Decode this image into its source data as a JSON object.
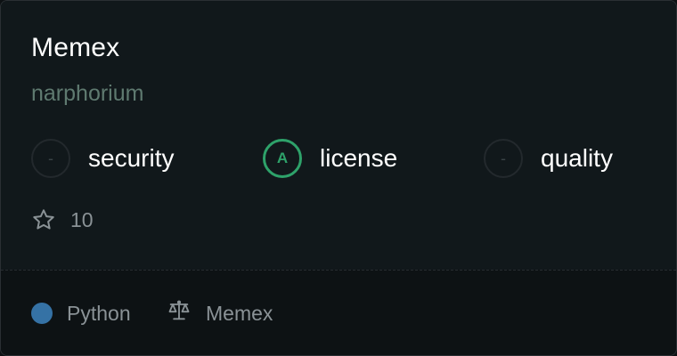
{
  "repo": {
    "name": "Memex",
    "owner": "narphorium"
  },
  "scores": [
    {
      "grade": "-",
      "label": "security",
      "state": "empty"
    },
    {
      "grade": "A",
      "label": "license",
      "state": "good"
    },
    {
      "grade": "-",
      "label": "quality",
      "state": "empty"
    }
  ],
  "stars": {
    "icon": "star-icon",
    "count": "10"
  },
  "footer": {
    "language": "Python",
    "language_color": "#3572A5",
    "license_icon": "scale-icon",
    "license": "Memex"
  },
  "colors": {
    "grade_good": "#2ea26a",
    "background": "#11181b"
  }
}
